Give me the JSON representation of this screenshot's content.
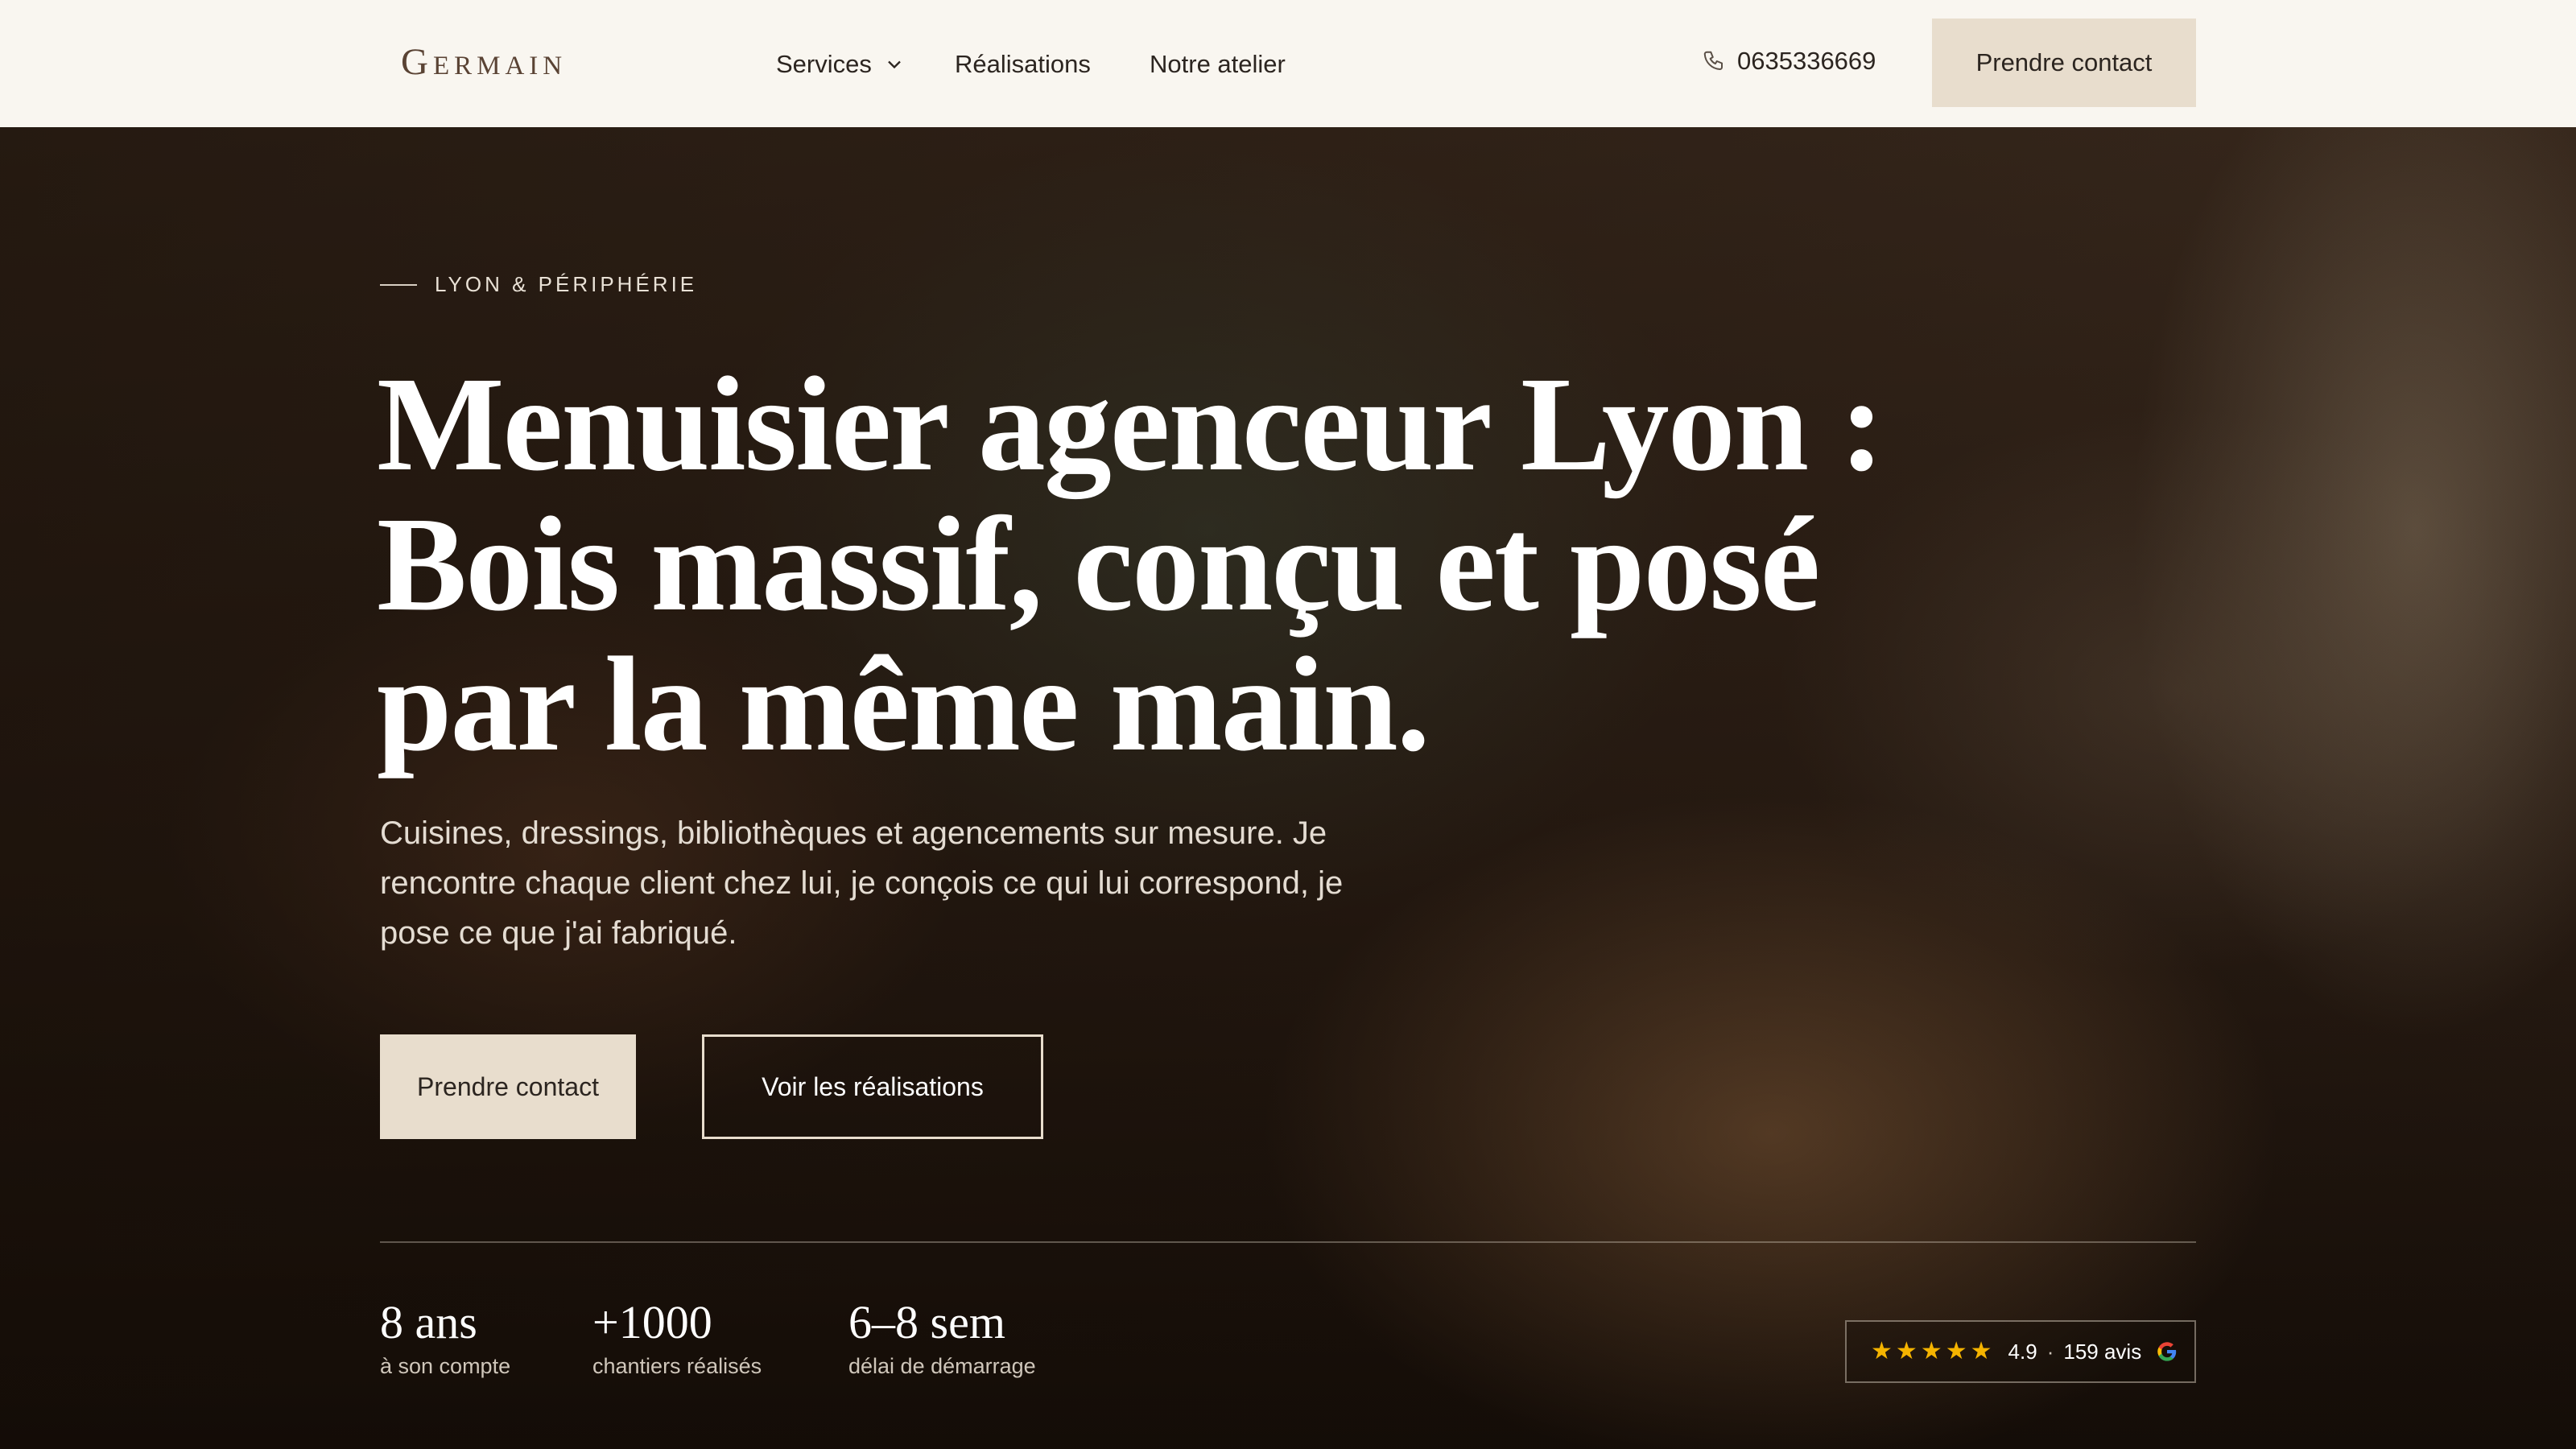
{
  "header": {
    "logo": "Germain",
    "nav": {
      "services": "Services",
      "realisations": "Réalisations",
      "atelier": "Notre atelier"
    },
    "phone": "0635336669",
    "cta": "Prendre contact"
  },
  "hero": {
    "eyebrow": "LYON & PÉRIPHÉRIE",
    "title_line1": "Menuisier agenceur Lyon :",
    "title_line2": "Bois massif, conçu et posé",
    "title_line3": "par la même main.",
    "subtitle": "Cuisines, dressings, bibliothèques et agencements sur mesure. Je rencontre chaque client chez lui, je conçois ce qui lui correspond, je pose ce que j'ai fabriqué.",
    "primary_button": "Prendre contact",
    "secondary_button": "Voir les réalisations"
  },
  "stats": [
    {
      "value": "8 ans",
      "label": "à son compte"
    },
    {
      "value": "+1000",
      "label": "chantiers réalisés"
    },
    {
      "value": "6–8 sem",
      "label": "délai de démarrage"
    }
  ],
  "reviews": {
    "stars": 5,
    "rating": "4.9",
    "separator": "·",
    "count": "159 avis",
    "icon": "google-icon"
  },
  "colors": {
    "header_bg": "#f9f6f0",
    "accent": "#e8ddcd",
    "text_dark": "#2c2520",
    "star": "#f5b400"
  }
}
